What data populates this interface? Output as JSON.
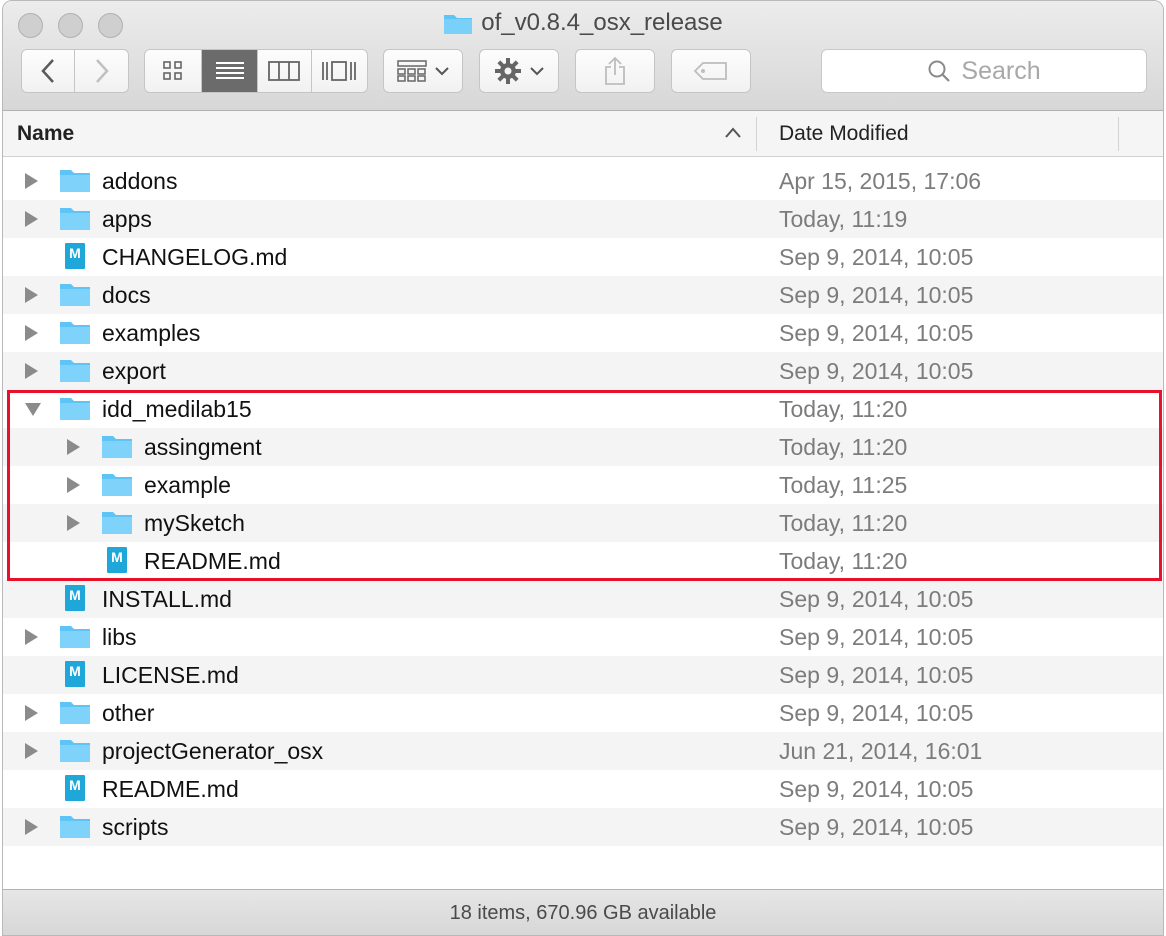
{
  "window": {
    "title": "of_v0.8.4_osx_release"
  },
  "toolbar": {
    "back_icon": "chevron-left-icon",
    "forward_icon": "chevron-right-icon",
    "search_placeholder": "Search"
  },
  "columns": {
    "name": "Name",
    "date_modified": "Date Modified"
  },
  "rows": [
    {
      "name": "addons",
      "date": "Apr 15, 2015, 17:06",
      "kind": "folder",
      "level": 0,
      "expandable": true
    },
    {
      "name": "apps",
      "date": "Today, 11:19",
      "kind": "folder",
      "level": 0,
      "expandable": true
    },
    {
      "name": "CHANGELOG.md",
      "date": "Sep 9, 2014, 10:05",
      "kind": "md",
      "level": 0,
      "expandable": false
    },
    {
      "name": "docs",
      "date": "Sep 9, 2014, 10:05",
      "kind": "folder",
      "level": 0,
      "expandable": true
    },
    {
      "name": "examples",
      "date": "Sep 9, 2014, 10:05",
      "kind": "folder",
      "level": 0,
      "expandable": true
    },
    {
      "name": "export",
      "date": "Sep 9, 2014, 10:05",
      "kind": "folder",
      "level": 0,
      "expandable": true
    },
    {
      "name": "idd_medilab15",
      "date": "Today, 11:20",
      "kind": "folder",
      "level": 0,
      "expandable": true,
      "open": true
    },
    {
      "name": "assingment",
      "date": "Today, 11:20",
      "kind": "folder",
      "level": 1,
      "expandable": true
    },
    {
      "name": "example",
      "date": "Today, 11:25",
      "kind": "folder",
      "level": 1,
      "expandable": true
    },
    {
      "name": "mySketch",
      "date": "Today, 11:20",
      "kind": "folder",
      "level": 1,
      "expandable": true
    },
    {
      "name": "README.md",
      "date": "Today, 11:20",
      "kind": "md",
      "level": 1,
      "expandable": false
    },
    {
      "name": "INSTALL.md",
      "date": "Sep 9, 2014, 10:05",
      "kind": "md",
      "level": 0,
      "expandable": false
    },
    {
      "name": "libs",
      "date": "Sep 9, 2014, 10:05",
      "kind": "folder",
      "level": 0,
      "expandable": true
    },
    {
      "name": "LICENSE.md",
      "date": "Sep 9, 2014, 10:05",
      "kind": "md",
      "level": 0,
      "expandable": false
    },
    {
      "name": "other",
      "date": "Sep 9, 2014, 10:05",
      "kind": "folder",
      "level": 0,
      "expandable": true
    },
    {
      "name": "projectGenerator_osx",
      "date": "Jun 21, 2014, 16:01",
      "kind": "folder",
      "level": 0,
      "expandable": true
    },
    {
      "name": "README.md",
      "date": "Sep 9, 2014, 10:05",
      "kind": "md",
      "level": 0,
      "expandable": false
    },
    {
      "name": "scripts",
      "date": "Sep 9, 2014, 10:05",
      "kind": "folder",
      "level": 0,
      "expandable": true
    }
  ],
  "md_badge": "M",
  "status": {
    "text": "18 items, 670.96 GB available"
  },
  "colors": {
    "folder": "#5ec4f5",
    "highlight": "#e8102b",
    "md_icon": "#1ea7d8"
  }
}
